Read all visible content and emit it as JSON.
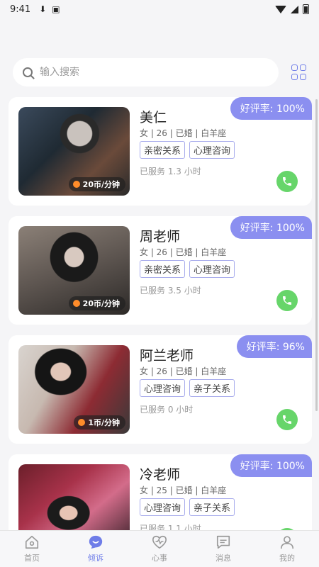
{
  "status_bar": {
    "time": "9:41"
  },
  "search": {
    "placeholder": "输入搜索"
  },
  "counselors": [
    {
      "name": "美仁",
      "meta": "女 | 26 | 已婚 | 白羊座",
      "tags": [
        "亲密关系",
        "心理咨询"
      ],
      "served": "已服务 1.3 小时",
      "price": "20币/分钟",
      "rating": "好评率: 100%"
    },
    {
      "name": "周老师",
      "meta": "女 | 26 | 已婚 | 白羊座",
      "tags": [
        "亲密关系",
        "心理咨询"
      ],
      "served": "已服务 3.5 小时",
      "price": "20币/分钟",
      "rating": "好评率: 100%"
    },
    {
      "name": "阿兰老师",
      "meta": "女 | 26 | 已婚 | 白羊座",
      "tags": [
        "心理咨询",
        "亲子关系"
      ],
      "served": "已服务 0 小时",
      "price": "1币/分钟",
      "rating": "好评率: 96%"
    },
    {
      "name": "冷老师",
      "meta": "女 | 25 | 已婚 | 白羊座",
      "tags": [
        "心理咨询",
        "亲子关系"
      ],
      "served": "已服务 1.1 小时",
      "price": "",
      "rating": "好评率: 100%"
    }
  ],
  "nav": [
    {
      "label": "首页",
      "icon": "home-icon"
    },
    {
      "label": "倾诉",
      "icon": "chat-bubble-icon"
    },
    {
      "label": "心事",
      "icon": "heart-pulse-icon"
    },
    {
      "label": "消息",
      "icon": "message-icon"
    },
    {
      "label": "我的",
      "icon": "user-icon"
    }
  ],
  "colors": {
    "accent": "#6f7de8",
    "rating_bg": "#8b8ff0",
    "call_green": "#67d56a",
    "coin": "#ff8c2a"
  }
}
